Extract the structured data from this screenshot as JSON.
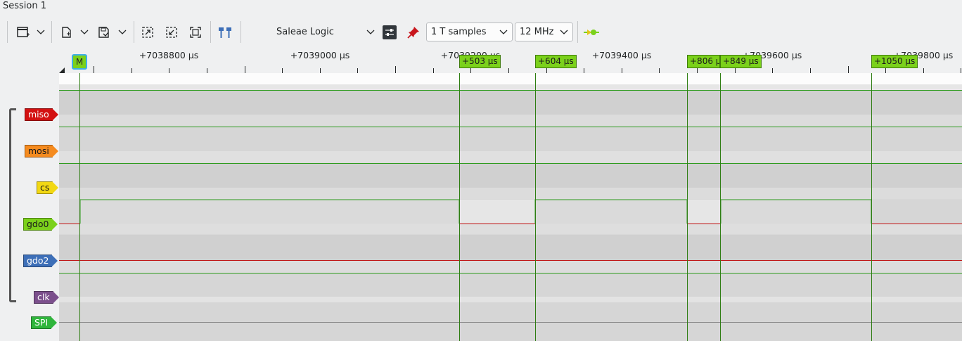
{
  "window": {
    "title": "Session 1"
  },
  "toolbar": {
    "device": "Saleae Logic",
    "samples": "1 T samples",
    "rate": "12 MHz"
  },
  "ruler": {
    "labels": [
      "+7038800 µs",
      "+7039000 µs",
      "+7039200 µs",
      "+7039400 µs",
      "+7039600 µs",
      "+7039800 µs"
    ]
  },
  "markers": {
    "main": "M",
    "flags": [
      "+503 µs",
      "+604 µs",
      "+806 µs",
      "+849 µs",
      "+1050 µs"
    ]
  },
  "channels": [
    {
      "name": "miso",
      "color": "#d31111"
    },
    {
      "name": "mosi",
      "color": "#f58b1f"
    },
    {
      "name": "cs",
      "color": "#f2d813"
    },
    {
      "name": "gdo0",
      "color": "#7bd11b"
    },
    {
      "name": "gdo2",
      "color": "#3d6fb8"
    },
    {
      "name": "clk",
      "color": "#7b4f8c"
    },
    {
      "name": "SPI",
      "color": "#2fb53c"
    }
  ],
  "colors": {
    "high": "#2e9c1e",
    "low": "#c01818",
    "marker": "#2e7d12"
  }
}
